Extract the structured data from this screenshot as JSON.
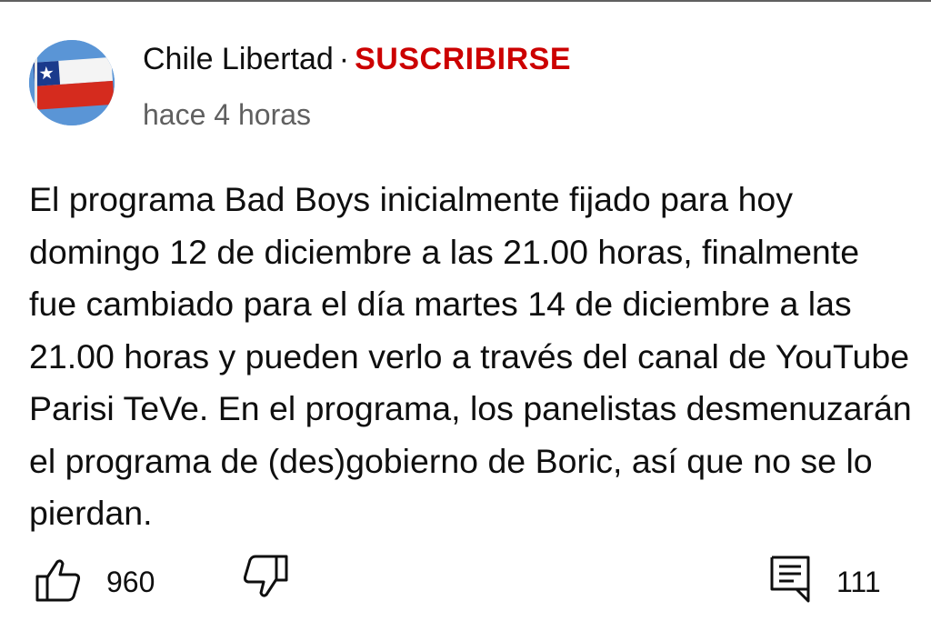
{
  "comment": {
    "channel_name": "Chile Libertad",
    "separator": "·",
    "subscribe_label": "SUSCRIBIRSE",
    "timestamp": "hace 4 horas",
    "text": "El programa Bad Boys inicialmente fijado para hoy domingo 12 de diciembre a las 21.00 horas, finalmente fue cambiado para el día martes 14 de diciembre a las 21.00 horas y pueden verlo a través del canal de YouTube Parisi TeVe. En el programa, los panelistas desmenuzarán el programa de (des)gobierno de Boric, así que no se lo pierdan.",
    "like_count": "960",
    "reply_count": "111"
  },
  "icons": {
    "avatar": "chile-flag-avatar",
    "like": "thumbs-up-icon",
    "dislike": "thumbs-down-icon",
    "replies": "comment-icon"
  },
  "colors": {
    "subscribe": "#cc0000",
    "secondary_text": "#606060",
    "primary_text": "#0f0f0f",
    "avatar_bg": "#5a95d6"
  }
}
